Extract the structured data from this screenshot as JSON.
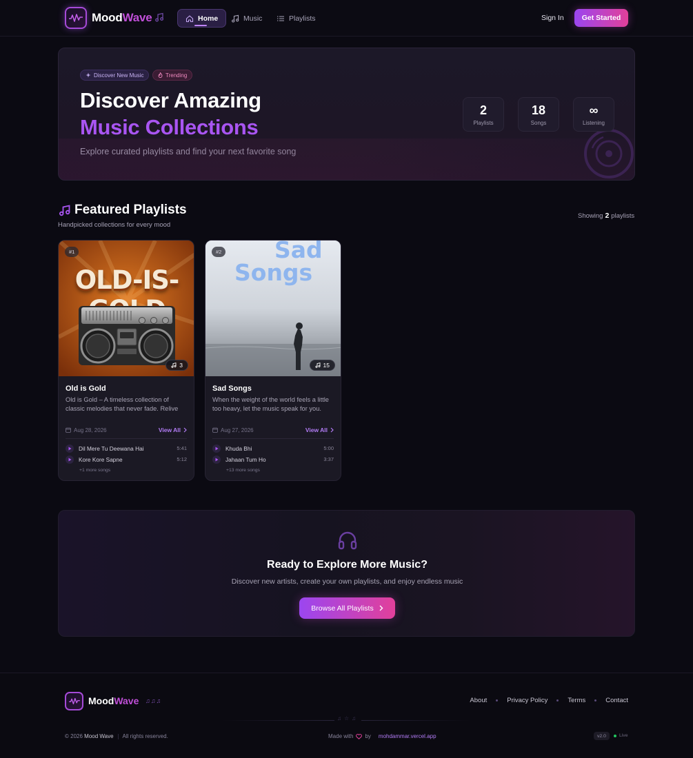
{
  "nav": {
    "brand_part1": "Mood",
    "brand_part2": "Wave",
    "tabs": [
      {
        "label": "Home",
        "icon": "home-icon",
        "active": true
      },
      {
        "label": "Music",
        "icon": "music-note-icon",
        "active": false
      },
      {
        "label": "Playlists",
        "icon": "list-icon",
        "active": false
      }
    ],
    "sign_in": "Sign In",
    "get_started": "Get Started"
  },
  "hero": {
    "badge_discover": "Discover New Music",
    "badge_trending": "Trending",
    "title_line1": "Discover Amazing",
    "title_line2": "Music Collections",
    "subtitle": "Explore curated playlists and find your next favorite song",
    "stats": [
      {
        "value": "2",
        "label": "Playlists"
      },
      {
        "value": "18",
        "label": "Songs"
      },
      {
        "value": "∞",
        "label": "Listening"
      }
    ]
  },
  "featured": {
    "title": "Featured Playlists",
    "subtitle": "Handpicked collections for every mood",
    "showing_prefix": "Showing",
    "showing_count": "2",
    "showing_suffix": "playlists"
  },
  "playlists": [
    {
      "rank": "#1",
      "cover_text": "OLD-IS-GOLD",
      "song_count": "3",
      "title": "Old is Gold",
      "description": "Old is Gold – A timeless collection of classic melodies that never fade. Relive the magic of golden era songs.",
      "date": "Aug 28, 2026",
      "view_all": "View All",
      "songs": [
        {
          "name": "Dil Mere Tu Deewana Hai",
          "duration": "5:41"
        },
        {
          "name": "Kore Kore Sapne",
          "duration": "5:12"
        }
      ],
      "more": "+1 more songs"
    },
    {
      "rank": "#2",
      "cover_text_line1": "Sad",
      "cover_text_line2": "Songs",
      "song_count": "15",
      "title": "Sad Songs",
      "description": "When the weight of the world feels a little too heavy, let the music speak for you. These songs understand.",
      "date": "Aug 27, 2026",
      "view_all": "View All",
      "songs": [
        {
          "name": "Khuda Bhi",
          "duration": "5:00"
        },
        {
          "name": "Jahaan Tum Ho",
          "duration": "3:37"
        }
      ],
      "more": "+13 more songs"
    }
  ],
  "cta": {
    "title": "Ready to Explore More Music?",
    "subtitle": "Discover new artists, create your own playlists, and enjoy endless music",
    "button": "Browse All Playlists"
  },
  "footer": {
    "brand_part1": "Mood",
    "brand_part2": "Wave",
    "notes": "♫♫♫",
    "links": [
      "About",
      "Privacy Policy",
      "Terms",
      "Contact"
    ],
    "deco": "♫☆♫",
    "copyright_prefix": "© 2026",
    "copyright_brand": "Mood Wave",
    "rights": "All rights reserved.",
    "made_with": "Made with",
    "by": "by",
    "link": "mohdammar.vercel.app",
    "version": "v2.0",
    "live": "Live"
  },
  "colors": {
    "accent_purple": "#a955f2",
    "accent_pink": "#e2409a",
    "background": "#0b0a12"
  }
}
